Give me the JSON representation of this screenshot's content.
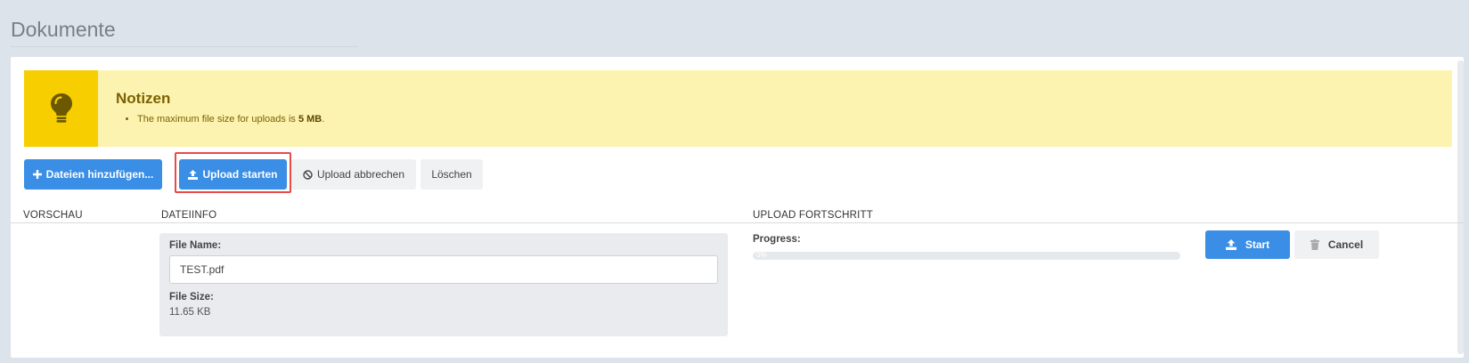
{
  "page": {
    "title": "Dokumente"
  },
  "note": {
    "title": "Notizen",
    "item_text": "The maximum file size for uploads is ",
    "item_value": "5 MB",
    "item_end": ".",
    "icon": "lightbulb-icon",
    "color_box": "#f7ce00",
    "color_bg": "#fdf3b0"
  },
  "toolbar": {
    "add_label": "Dateien hinzufügen...",
    "start_label": "Upload starten",
    "cancel_label": "Upload abbrechen",
    "delete_label": "Löschen"
  },
  "table": {
    "headers": [
      "VORSCHAU",
      "DATEIINFO",
      "UPLOAD FORTSCHRITT"
    ]
  },
  "file": {
    "name_label": "File Name:",
    "name_value": "TEST.pdf",
    "size_label": "File Size:",
    "size_value": "11.65 KB",
    "progress_label": "Progress:",
    "progress_text": "0%",
    "progress": 0,
    "start_label": "Start",
    "cancel_label": "Cancel"
  },
  "colors": {
    "primary": "#3a8ee6",
    "highlight": "#e84a4a"
  }
}
